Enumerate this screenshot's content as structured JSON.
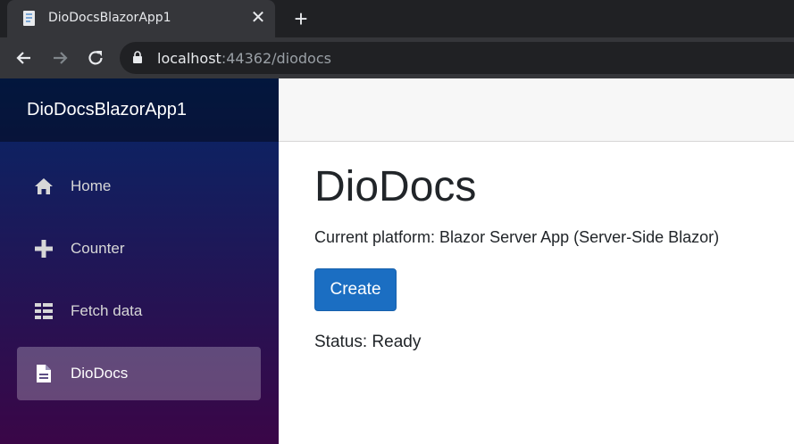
{
  "browser": {
    "tab_title": "DioDocsBlazorApp1",
    "close_glyph": "✕",
    "new_tab_glyph": "+",
    "url_host": "localhost",
    "url_rest": ":44362/diodocs"
  },
  "sidebar": {
    "brand": "DioDocsBlazorApp1",
    "items": [
      {
        "label": "Home",
        "icon": "home-icon"
      },
      {
        "label": "Counter",
        "icon": "plus-icon"
      },
      {
        "label": "Fetch data",
        "icon": "list-icon"
      },
      {
        "label": "DioDocs",
        "icon": "document-icon"
      }
    ],
    "active_index": 3
  },
  "main": {
    "title": "DioDocs",
    "platform_text": "Current platform: Blazor Server App (Server-Side Blazor)",
    "create_label": "Create",
    "status_text": "Status: Ready"
  },
  "colors": {
    "accent": "#1b6ec2",
    "sidebar_top": "#052767",
    "sidebar_bottom": "#3a0647"
  }
}
